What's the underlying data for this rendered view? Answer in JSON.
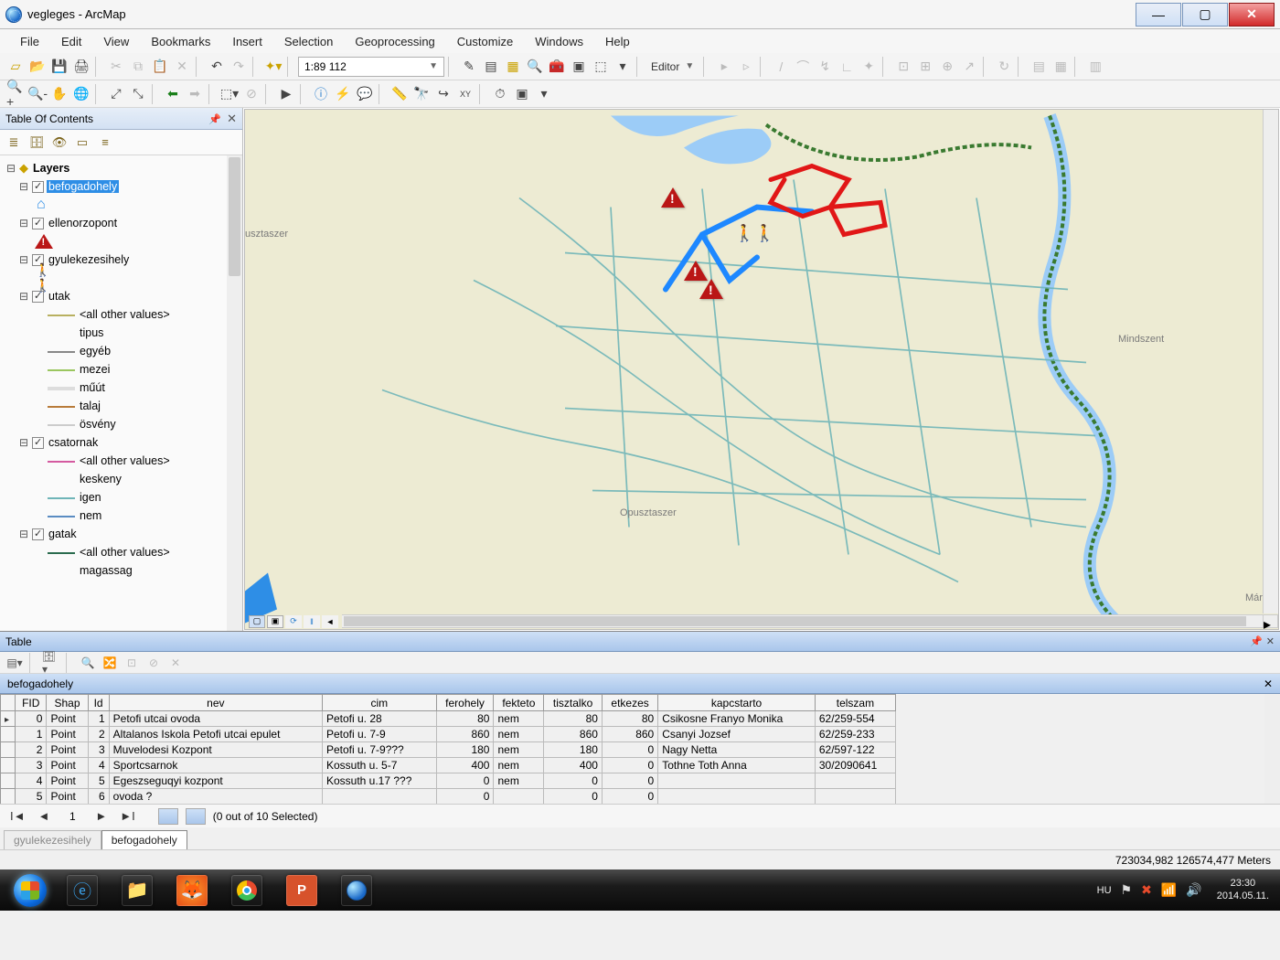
{
  "window": {
    "title": "vegleges - ArcMap"
  },
  "menu": [
    "File",
    "Edit",
    "View",
    "Bookmarks",
    "Insert",
    "Selection",
    "Geoprocessing",
    "Customize",
    "Windows",
    "Help"
  ],
  "scale": "1:89 112",
  "editor_label": "Editor",
  "toc": {
    "title": "Table Of Contents",
    "root": "Layers",
    "selected_layer": "befogadohely",
    "layers": {
      "befogadohely": "befogadohely",
      "ellenorzopont": "ellenorzopont",
      "gyulekezesihely": "gyulekezesihely",
      "utak": "utak",
      "csatornak": "csatornak",
      "gatak": "gatak"
    },
    "utak_items": {
      "all": "<all other values>",
      "tipus": "tipus",
      "egyeb": "egyéb",
      "mezei": "mezei",
      "muut": "műút",
      "talaj": "talaj",
      "osveny": "ösvény"
    },
    "csatornak_items": {
      "all": "<all other values>",
      "keskeny": "keskeny",
      "igen": "igen",
      "nem": "nem"
    },
    "gatak_items": {
      "all": "<all other values>",
      "magassag": "magassag"
    }
  },
  "map_labels": {
    "usztaszer": "usztaszer",
    "opusztaszer": "Opusztaszer",
    "mindszent": "Mindszent",
    "martely": "Mártély"
  },
  "table": {
    "panel_title": "Table",
    "layer_name": "befogadohely",
    "other_tab": "gyulekezesihely",
    "columns": [
      "FID",
      "Shap",
      "Id",
      "nev",
      "cim",
      "ferohely",
      "fekteto",
      "tisztalko",
      "etkezes",
      "kapcstarto",
      "telszam"
    ],
    "rows": [
      {
        "fid": "0",
        "shap": "Point",
        "id": "1",
        "nev": "Petofi utcai ovoda",
        "cim": "Petofi u. 28",
        "ferohely": "80",
        "fekteto": "nem",
        "tisztalko": "80",
        "etkezes": "80",
        "kapcstarto": "Csikosne Franyo Monika",
        "telszam": "62/259-554"
      },
      {
        "fid": "1",
        "shap": "Point",
        "id": "2",
        "nev": "Altalanos Iskola Petofi utcai epulet",
        "cim": "Petofi u. 7-9",
        "ferohely": "860",
        "fekteto": "nem",
        "tisztalko": "860",
        "etkezes": "860",
        "kapcstarto": "Csanyi Jozsef",
        "telszam": "62/259-233"
      },
      {
        "fid": "2",
        "shap": "Point",
        "id": "3",
        "nev": "Muvelodesi Kozpont",
        "cim": "Petofi u. 7-9???",
        "ferohely": "180",
        "fekteto": "nem",
        "tisztalko": "180",
        "etkezes": "0",
        "kapcstarto": "Nagy Netta",
        "telszam": "62/597-122"
      },
      {
        "fid": "3",
        "shap": "Point",
        "id": "4",
        "nev": "Sportcsarnok",
        "cim": "Kossuth u. 5-7",
        "ferohely": "400",
        "fekteto": "nem",
        "tisztalko": "400",
        "etkezes": "0",
        "kapcstarto": "Tothne Toth Anna",
        "telszam": "30/2090641"
      },
      {
        "fid": "4",
        "shap": "Point",
        "id": "5",
        "nev": "Egeszseguqyi kozpont",
        "cim": "Kossuth u.17 ???",
        "ferohely": "0",
        "fekteto": "nem",
        "tisztalko": "0",
        "etkezes": "0",
        "kapcstarto": "",
        "telszam": ""
      },
      {
        "fid": "5",
        "shap": "Point",
        "id": "6",
        "nev": "ovoda ?",
        "cim": "",
        "ferohely": "0",
        "fekteto": "",
        "tisztalko": "0",
        "etkezes": "0",
        "kapcstarto": "",
        "telszam": ""
      }
    ],
    "nav_page": "1",
    "selection": "(0 out of 10 Selected)"
  },
  "status": {
    "coords": "723034,982  126574,477 Meters"
  },
  "taskbar": {
    "lang": "HU",
    "time": "23:30",
    "date": "2014.05.11."
  }
}
